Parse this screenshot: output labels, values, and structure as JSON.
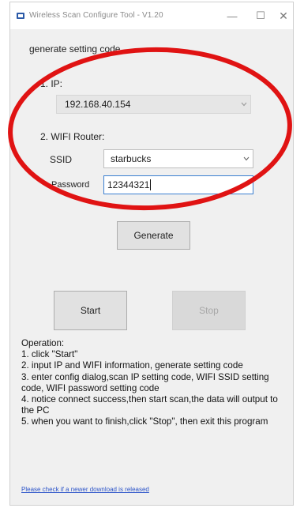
{
  "window": {
    "title": "Wireless Scan Configure Tool - V1.20",
    "minimize_glyph": "—",
    "maximize_glyph": "☐",
    "close_glyph": "✕"
  },
  "section": {
    "header": "generate setting code"
  },
  "ip": {
    "label": "1. IP:",
    "value": "192.168.40.154"
  },
  "wifi": {
    "label": "2. WIFI Router:",
    "ssid_label": "SSID",
    "ssid_value": "starbucks",
    "password_label": "Password",
    "password_value": "12344321"
  },
  "buttons": {
    "generate": "Generate",
    "start": "Start",
    "stop": "Stop"
  },
  "instructions": {
    "heading": "Operation:",
    "steps": [
      "1. click \"Start\"",
      "2. input IP and WIFI information, generate setting code",
      "3. enter config dialog,scan IP setting code, WIFI SSID setting code, WIFI password setting code",
      "4. notice connect success,then start scan,the data will output to the PC",
      "5. when you want to finish,click \"Stop\", then exit this program"
    ]
  },
  "footer": {
    "link_text": "Please check if a newer download is released"
  },
  "colors": {
    "annotation_ring": "#e01313",
    "window_bg": "#f0f0f0",
    "focus_border": "#3b7fd1",
    "link": "#2d55c9"
  },
  "icons": {
    "app": "app-icon",
    "dropdown": "chevron-down-icon"
  }
}
